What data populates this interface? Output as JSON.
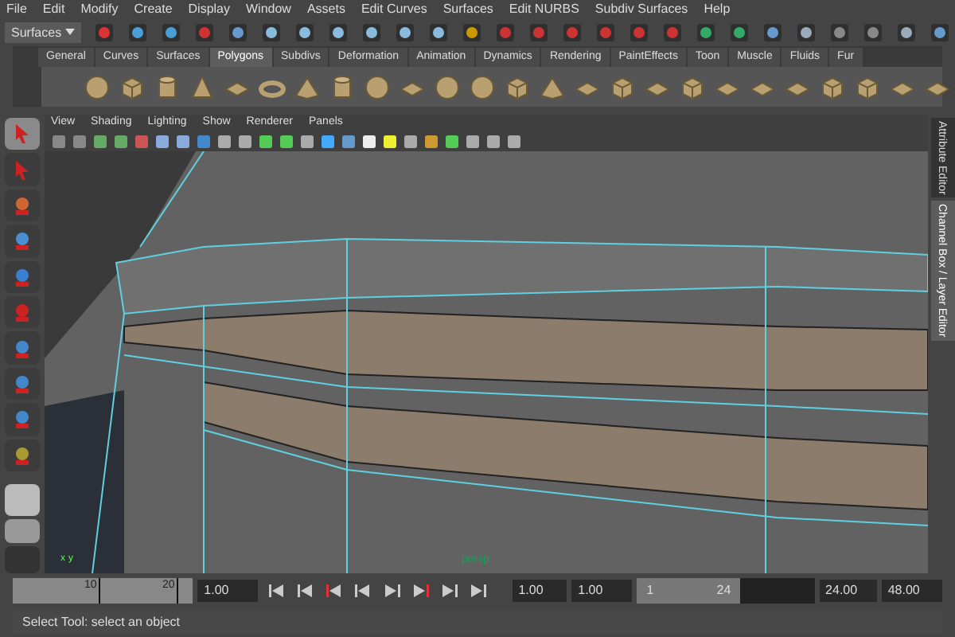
{
  "menu_bar": [
    "File",
    "Edit",
    "Modify",
    "Create",
    "Display",
    "Window",
    "Assets",
    "Edit Curves",
    "Surfaces",
    "Edit NURBS",
    "Subdiv Surfaces",
    "Help"
  ],
  "menu_set": "Surfaces",
  "shelf_tabs": [
    {
      "label": "General",
      "selected": false
    },
    {
      "label": "Curves",
      "selected": false
    },
    {
      "label": "Surfaces",
      "selected": false
    },
    {
      "label": "Polygons",
      "selected": true
    },
    {
      "label": "Subdivs",
      "selected": false
    },
    {
      "label": "Deformation",
      "selected": false
    },
    {
      "label": "Animation",
      "selected": false
    },
    {
      "label": "Dynamics",
      "selected": false
    },
    {
      "label": "Rendering",
      "selected": false
    },
    {
      "label": "PaintEffects",
      "selected": false
    },
    {
      "label": "Toon",
      "selected": false
    },
    {
      "label": "Muscle",
      "selected": false
    },
    {
      "label": "Fluids",
      "selected": false
    },
    {
      "label": "Fur",
      "selected": false
    }
  ],
  "panel_menu": [
    "View",
    "Shading",
    "Lighting",
    "Show",
    "Renderer",
    "Panels"
  ],
  "viewport": {
    "camera_label": "persp",
    "axis_labels": [
      "x",
      "y"
    ]
  },
  "side_tabs": [
    {
      "label": "Attribute Editor",
      "selected": false
    },
    {
      "label": "Channel Box / Layer Editor",
      "selected": true
    }
  ],
  "time_slider": {
    "ticks": [
      "10",
      "20"
    ]
  },
  "current_time": "1.00",
  "range": {
    "level": 0.55,
    "start": "1.00",
    "playback_start": "1.00",
    "slider_start": "1",
    "slider_end": "24",
    "playback_end": "24.00",
    "end": "48.00"
  },
  "status_line": "Select Tool: select an object"
}
